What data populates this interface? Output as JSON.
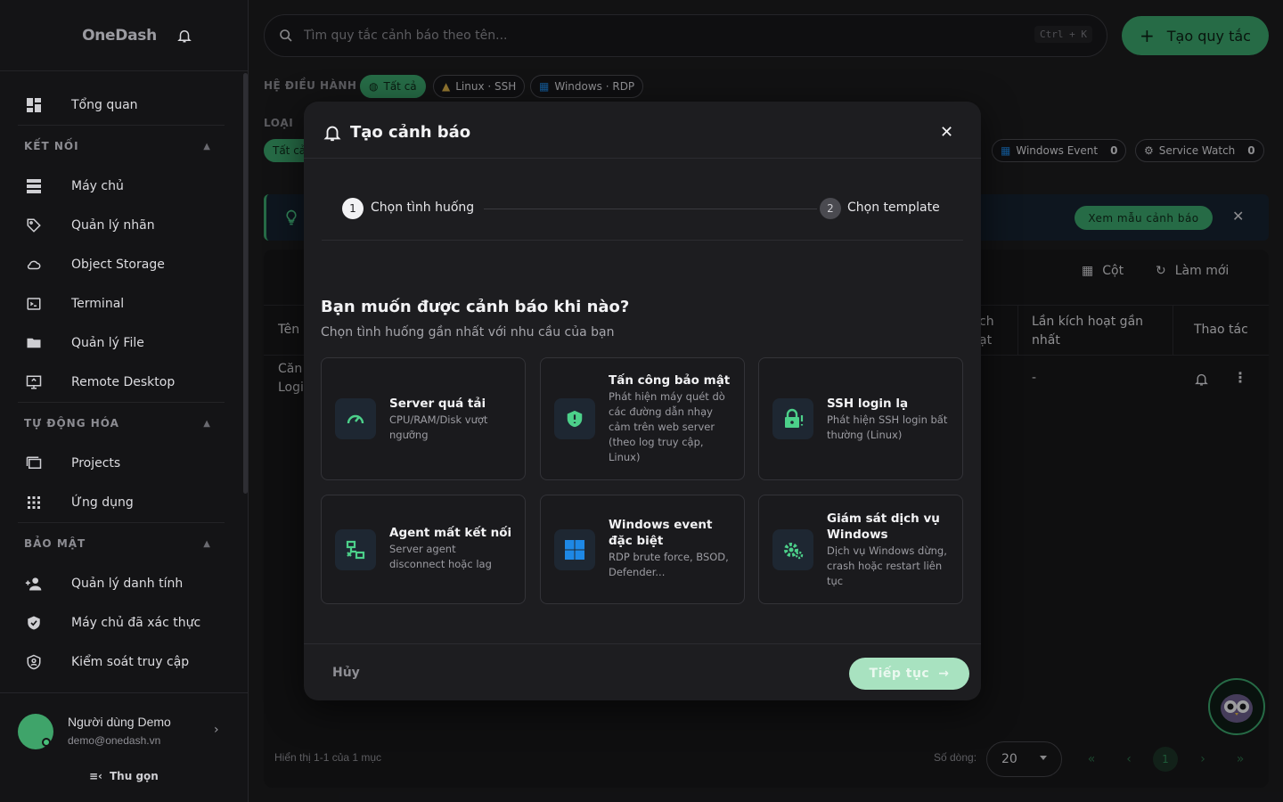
{
  "app": {
    "brand": "OneDash"
  },
  "sidebar": {
    "items_top": [
      {
        "label": "Tổng quan",
        "icon": "dashboard-icon"
      }
    ],
    "sections": [
      {
        "title": "KẾT NỐI",
        "items": [
          {
            "label": "Máy chủ",
            "icon": "server-icon"
          },
          {
            "label": "Quản lý nhãn",
            "icon": "tag-icon"
          },
          {
            "label": "Object Storage",
            "icon": "cloud-icon"
          },
          {
            "label": "Terminal",
            "icon": "terminal-icon"
          },
          {
            "label": "Quản lý File",
            "icon": "folder-icon"
          },
          {
            "label": "Remote Desktop",
            "icon": "remote-desktop-icon"
          }
        ]
      },
      {
        "title": "TỰ ĐỘNG HÓA",
        "items": [
          {
            "label": "Projects",
            "icon": "projects-icon"
          },
          {
            "label": "Ứng dụng",
            "icon": "apps-grid-icon"
          }
        ]
      },
      {
        "title": "BẢO MẬT",
        "items": [
          {
            "label": "Quản lý danh tính",
            "icon": "users-icon"
          },
          {
            "label": "Máy chủ đã xác thực",
            "icon": "shield-check-icon"
          },
          {
            "label": "Kiểm soát truy cập",
            "icon": "access-control-icon"
          }
        ]
      }
    ],
    "user": {
      "name": "Người dùng Demo",
      "email": "demo@onedash.vn"
    },
    "collapse_label": "Thu gọn"
  },
  "search": {
    "placeholder": "Tìm quy tắc cảnh báo theo tên...",
    "shortcut": "Ctrl + K"
  },
  "create_button": "Tạo quy tắc",
  "filters": {
    "os_label": "HỆ ĐIỀU HÀNH",
    "os_chips": [
      "Tất cả",
      "Linux · SSH",
      "Windows · RDP"
    ],
    "type_label": "LOẠI",
    "type_first_chip": "Tất cả",
    "type_chips_right": [
      {
        "label": "Windows Event",
        "count": "0"
      },
      {
        "label": "Service Watch",
        "count": "0"
      }
    ]
  },
  "banner": {
    "button": "Xem mẫu cảnh báo"
  },
  "table": {
    "toolbar": {
      "columns": "Cột",
      "refresh": "Làm mới"
    },
    "headers": {
      "name": "Tên",
      "partial": "ch\nạt",
      "last_triggered": "Lần kích hoạt gần nhất",
      "actions": "Thao tác"
    },
    "row": {
      "name_partial": "Căn\nLogi",
      "last_triggered": "-"
    },
    "footer": {
      "summary": "Hiển thị 1-1 của 1 mục",
      "rows_label": "Số dòng:",
      "rows_value": "20",
      "page": "1"
    }
  },
  "modal": {
    "title": "Tạo cảnh báo",
    "steps": [
      {
        "num": "1",
        "label": "Chọn tình huống"
      },
      {
        "num": "2",
        "label": "Chọn template"
      }
    ],
    "question": "Bạn muốn được cảnh báo khi nào?",
    "subtitle": "Chọn tình huống gần nhất với nhu cầu của bạn",
    "cards": [
      {
        "title": "Server quá tải",
        "desc": "CPU/RAM/Disk vượt ngưỡng",
        "icon": "gauge-icon"
      },
      {
        "title": "Tấn công bảo mật",
        "desc": "Phát hiện máy quét dò các đường dẫn nhạy cảm trên web server (theo log truy cập, Linux)",
        "icon": "shield-alert-icon"
      },
      {
        "title": "SSH login lạ",
        "desc": "Phát hiện SSH login bất thường (Linux)",
        "icon": "lock-alert-icon"
      },
      {
        "title": "Agent mất kết nối",
        "desc": "Server agent disconnect hoặc lag",
        "icon": "network-off-icon"
      },
      {
        "title": "Windows event đặc biệt",
        "desc": "RDP brute force, BSOD, Defender...",
        "icon": "windows-icon"
      },
      {
        "title": "Giám sát dịch vụ Windows",
        "desc": "Dịch vụ Windows dừng, crash hoặc restart liên tục",
        "icon": "service-gear-icon"
      }
    ],
    "cancel": "Hủy",
    "next": "Tiếp tục"
  },
  "colors": {
    "accent": "#3ba56c",
    "icon_accent": "#4cd08a",
    "windows_blue": "#1e88e5"
  }
}
